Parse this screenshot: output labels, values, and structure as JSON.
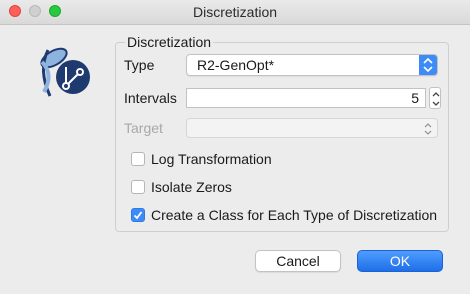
{
  "window": {
    "title": "Discretization",
    "controls": [
      "close",
      "minimize",
      "maximize"
    ]
  },
  "colors": {
    "accent": "#3d8bf7",
    "background": "#ececec",
    "icon_dark": "#1f3a6e",
    "icon_light": "#8fb3df"
  },
  "app_icon": {
    "name": "discretization-app-icon"
  },
  "group": {
    "title": "Discretization",
    "type_label": "Type",
    "type_value": "R2-GenOpt*",
    "intervals_label": "Intervals",
    "intervals_value": "5",
    "target_label": "Target",
    "target_value": "",
    "checkboxes": [
      {
        "label": "Log Transformation",
        "checked": false
      },
      {
        "label": "Isolate Zeros",
        "checked": false
      },
      {
        "label": "Create a Class for Each Type of Discretization",
        "checked": true
      }
    ]
  },
  "buttons": {
    "cancel": "Cancel",
    "ok": "OK"
  }
}
